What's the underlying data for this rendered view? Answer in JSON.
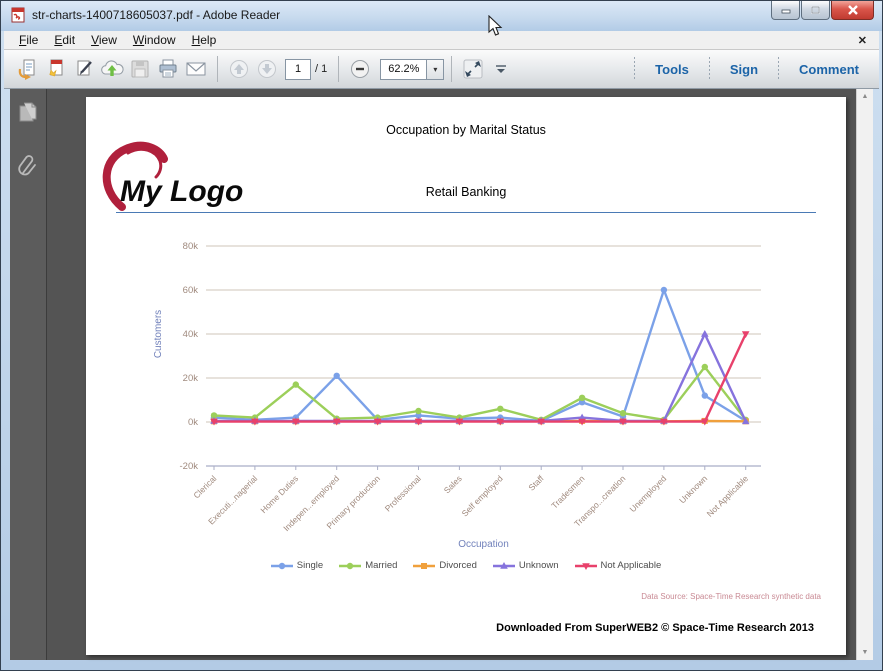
{
  "window": {
    "title": "str-charts-1400718605037.pdf - Adobe Reader"
  },
  "menu": {
    "items": [
      "File",
      "Edit",
      "View",
      "Window",
      "Help"
    ]
  },
  "icons": {
    "menu_close_glyph": "✕",
    "zoom_dropdown_glyph": "▾",
    "scroll_up_glyph": "▲",
    "scroll_down_glyph": "▼"
  },
  "toolbar": {
    "page_current": "1",
    "page_total": "/ 1",
    "zoom_value": "62.2%",
    "tools_label": "Tools",
    "sign_label": "Sign",
    "comment_label": "Comment"
  },
  "document": {
    "title": "Occupation by Marital Status",
    "logo_text": "My Logo",
    "subtitle": "Retail Banking",
    "data_source": "Data Source: Space-Time Research synthetic data",
    "footer": "Downloaded From SuperWEB2 © Space-Time Research 2013"
  },
  "chart_data": {
    "type": "line",
    "title": "Occupation by Marital Status",
    "xlabel": "Occupation",
    "ylabel": "Customers",
    "unit": "thousands",
    "ylim": [
      -20,
      80
    ],
    "grid": true,
    "legend_position": "bottom",
    "yticks": [
      {
        "label": "80k",
        "v": 80
      },
      {
        "label": "60k",
        "v": 60
      },
      {
        "label": "40k",
        "v": 40
      },
      {
        "label": "20k",
        "v": 20
      },
      {
        "label": "0k",
        "v": 0
      },
      {
        "label": "-20k",
        "v": -20
      }
    ],
    "categories": [
      "Clerical",
      "Executi...nagerial",
      "Home Duties",
      "Indepen...employed",
      "Primary production",
      "Professional",
      "Sales",
      "Self employed",
      "Staff",
      "Tradesmen",
      "Transpo...creation",
      "Unemployed",
      "Unknown",
      "Not Applicable"
    ],
    "series": [
      {
        "name": "Single",
        "color": "#7ba1e8",
        "marker": "circle",
        "values": [
          2,
          1,
          2,
          21,
          1,
          3,
          1.5,
          2,
          0.5,
          9,
          2.5,
          60,
          12,
          0.5
        ]
      },
      {
        "name": "Married",
        "color": "#9ccf5a",
        "marker": "circle",
        "values": [
          3,
          2,
          17,
          1.5,
          2,
          5,
          2,
          6,
          1,
          11,
          4,
          1,
          25,
          1
        ]
      },
      {
        "name": "Divorced",
        "color": "#f0a03c",
        "marker": "square",
        "values": [
          0.3,
          0.3,
          0.3,
          0.3,
          0.3,
          0.3,
          0.3,
          0.3,
          0.3,
          0.5,
          0.3,
          0.3,
          0.5,
          0.3
        ]
      },
      {
        "name": "Unknown",
        "color": "#8673dd",
        "marker": "triangle",
        "values": [
          0.5,
          0.5,
          0.5,
          0.5,
          0.5,
          0.5,
          0.5,
          0.5,
          0.5,
          2,
          0.5,
          0.5,
          40,
          0.3
        ]
      },
      {
        "name": "Not Applicable",
        "color": "#e8416b",
        "marker": "triangle-down",
        "values": [
          0.2,
          0.2,
          0.2,
          0.2,
          0.2,
          0.2,
          0.2,
          0.2,
          0.2,
          0.2,
          0.2,
          0.2,
          0.2,
          40
        ]
      }
    ],
    "colors": {
      "gridline": "#cfc4ba",
      "axis_line": "#a9aec6",
      "tick_text": "#a08a7e",
      "axis_title": "#7282bb"
    }
  }
}
